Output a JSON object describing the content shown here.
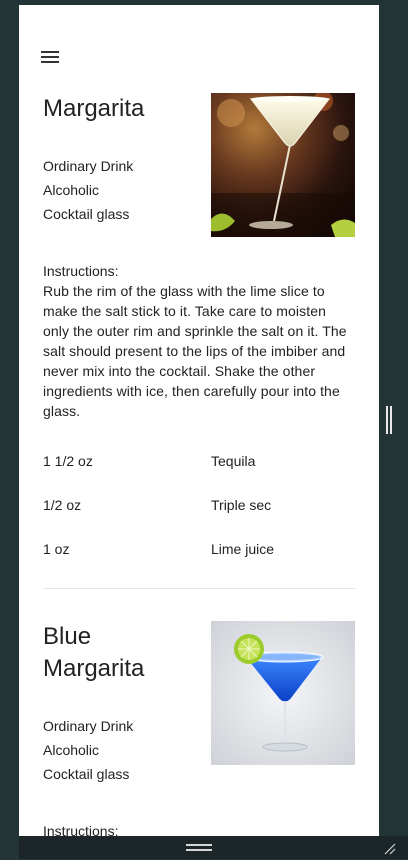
{
  "menu": {
    "icon": "hamburger-menu-icon"
  },
  "drinks": [
    {
      "name": "Margarita",
      "category": "Ordinary Drink",
      "alcoholic": "Alcoholic",
      "glass": "Cocktail glass",
      "instructions_label": "Instructions:",
      "instructions": "Rub the rim of the glass with the lime slice to make the salt stick to it. Take care to moisten only the outer rim and sprinkle the salt on it. The salt should present to the lips of the imbiber and never mix into the cocktail. Shake the other ingredients with ice, then carefully pour into the glass.",
      "ingredients": [
        {
          "measure": "1 1/2 oz",
          "name": "Tequila"
        },
        {
          "measure": "1/2 oz",
          "name": "Triple sec"
        },
        {
          "measure": "1 oz",
          "name": "Lime juice"
        }
      ]
    },
    {
      "name": "Blue Margarita",
      "category": "Ordinary Drink",
      "alcoholic": "Alcoholic",
      "glass": "Cocktail glass",
      "instructions_label": "Instructions:"
    }
  ]
}
